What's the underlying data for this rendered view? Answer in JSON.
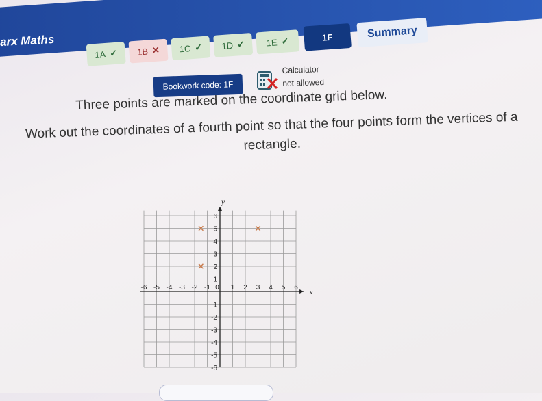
{
  "browser": {
    "url": "maths.sparx-learning.com"
  },
  "header": {
    "brand": "arx Maths"
  },
  "tabs": [
    {
      "label": "1A",
      "status": "correct",
      "mark": "✓"
    },
    {
      "label": "1B",
      "status": "wrong",
      "mark": "✕"
    },
    {
      "label": "1C",
      "status": "correct",
      "mark": "✓"
    },
    {
      "label": "1D",
      "status": "correct",
      "mark": "✓"
    },
    {
      "label": "1E",
      "status": "correct",
      "mark": "✓"
    },
    {
      "label": "1F",
      "status": "current",
      "mark": ""
    },
    {
      "label": "Summary",
      "status": "summary",
      "mark": ""
    }
  ],
  "bookwork": {
    "label": "Bookwork code: 1F"
  },
  "calculator": {
    "line1": "Calculator",
    "line2": "not allowed",
    "icon": "calculator-crossed-icon"
  },
  "question": {
    "line1": "Three points are marked on the coordinate grid below.",
    "line2": "Work out the coordinates of a fourth point so that the four points form the vertices of a rectangle."
  },
  "chart_data": {
    "type": "scatter",
    "xlabel": "x",
    "ylabel": "y",
    "xlim": [
      -6,
      6
    ],
    "ylim": [
      -6,
      6
    ],
    "x_ticks": [
      "-6",
      "-5",
      "-4",
      "-3",
      "-2",
      "-1",
      "0",
      "1",
      "2",
      "3",
      "4",
      "5",
      "6"
    ],
    "y_ticks": [
      "6",
      "5",
      "4",
      "3",
      "2",
      "1",
      "-1",
      "-2",
      "-3",
      "-4",
      "-5",
      "-6"
    ],
    "grid": true,
    "points": [
      {
        "x": -1.5,
        "y": 5
      },
      {
        "x": 3,
        "y": 5
      },
      {
        "x": -1.5,
        "y": 2
      }
    ],
    "marker": "x",
    "marker_color": "#c87a4a"
  }
}
